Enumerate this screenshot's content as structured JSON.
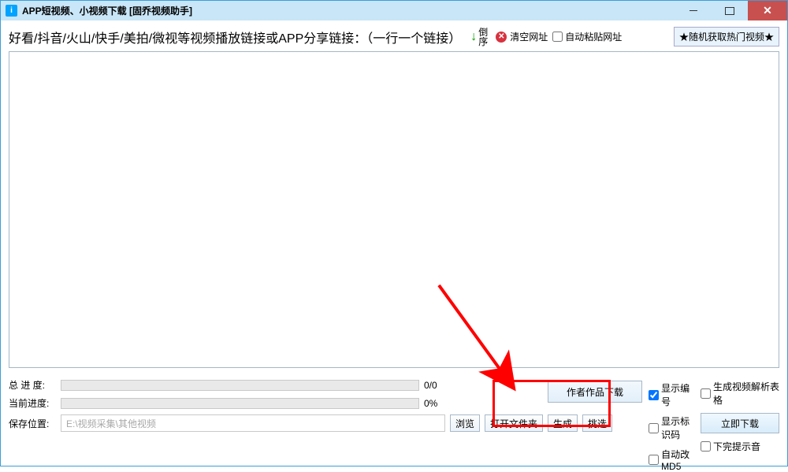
{
  "title": "APP短视频、小视频下载 [固乔视频助手]",
  "toolbar": {
    "hint": "好看/抖音/火山/快手/美拍/微视等视频播放链接或APP分享链接：（一行一个链接）",
    "sort_label": "倒\n序",
    "clear_label": "清空网址",
    "auto_paste_label": "自动粘贴网址",
    "random_hot_label": "★随机获取热门视频★"
  },
  "progress": {
    "total_label": "总 进 度:",
    "total_value": "0/0",
    "current_label": "当前进度:",
    "current_value": "0%"
  },
  "save": {
    "label": "保存位置:",
    "path": "E:\\视频采集\\其他视频",
    "browse": "浏览",
    "open_folder": "打开文件夹",
    "generate": "生成",
    "pick": "挑选"
  },
  "actions": {
    "author_download": "作者作品下载",
    "download_now": "立即下载"
  },
  "options": {
    "show_index": "显示编号",
    "show_id": "显示标识码",
    "auto_md5": "自动改MD5",
    "gen_parse_table": "生成视频解析表格",
    "done_sound": "下完提示音"
  }
}
